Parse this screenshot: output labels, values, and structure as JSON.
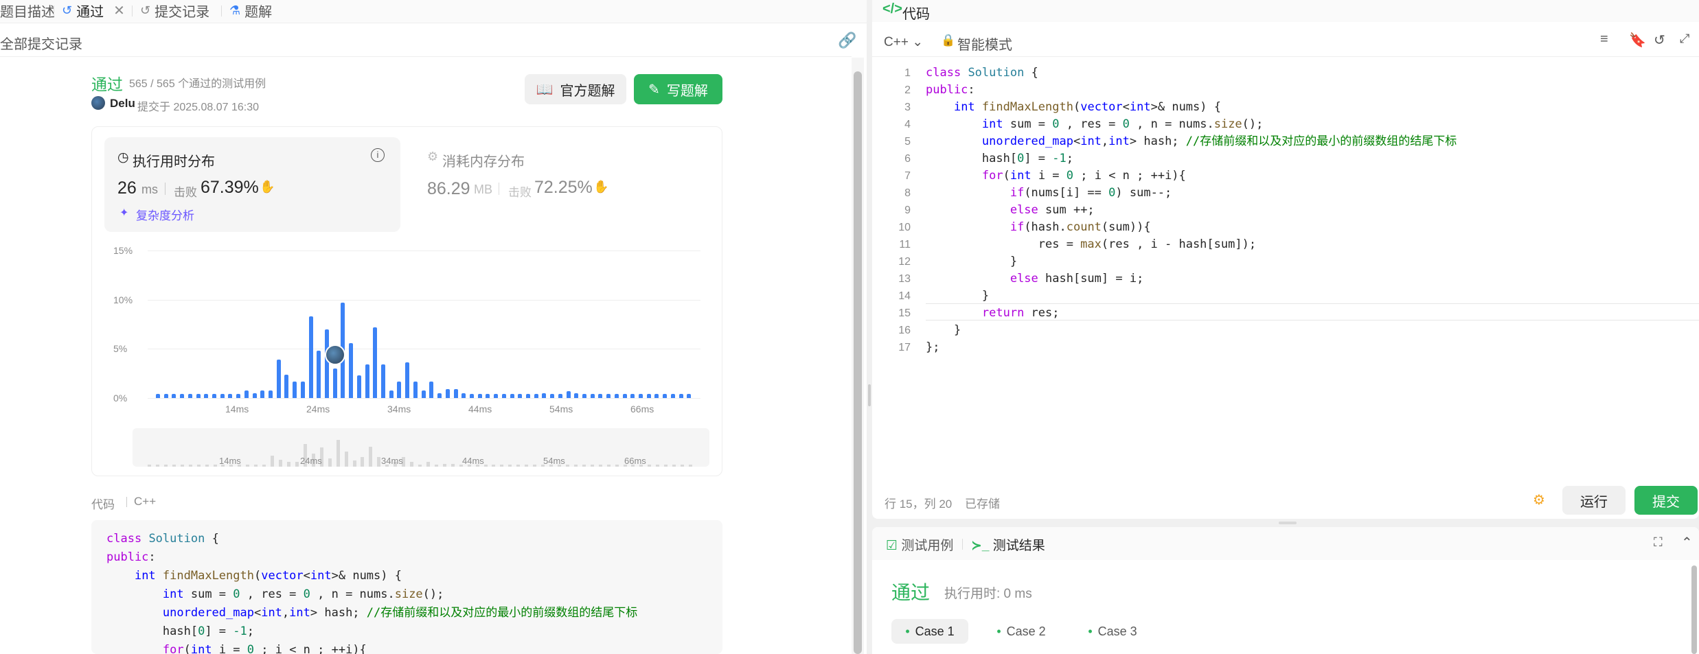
{
  "tabs": {
    "description": "题目描述",
    "passed": "通过",
    "submissions": "提交记录",
    "solutions": "题解"
  },
  "left": {
    "all_submissions": "全部提交记录",
    "status": "通过",
    "testcases": "565 / 565 个通过的测试用例",
    "user": "Delu",
    "submitted_at": "提交于 2025.08.07 16:30",
    "official_solution": "官方题解",
    "write_solution": "写题解",
    "runtime_title": "执行用时分布",
    "runtime_value": "26",
    "runtime_unit": "ms",
    "beats_label": "击败",
    "runtime_beats": "67.39%",
    "complexity": "复杂度分析",
    "memory_title": "消耗内存分布",
    "memory_value": "86.29",
    "memory_unit": "MB",
    "memory_beats": "72.25%",
    "code_label": "代码",
    "lang": "C++"
  },
  "chart_data": {
    "type": "bar",
    "title": "执行用时分布",
    "y_ticks": [
      "15%",
      "10%",
      "5%",
      "0%"
    ],
    "x_ticks": [
      "14ms",
      "24ms",
      "34ms",
      "44ms",
      "54ms",
      "66ms"
    ],
    "ylim": [
      0,
      15
    ],
    "values": [
      0.4,
      0.4,
      0.4,
      0.4,
      0.4,
      0.4,
      0.4,
      0.4,
      0.4,
      0.4,
      0.4,
      0.8,
      0.5,
      0.8,
      0.8,
      3.9,
      2.4,
      1.7,
      1.7,
      8.3,
      4.8,
      7.0,
      3.0,
      9.7,
      5.6,
      2.3,
      3.4,
      7.2,
      3.4,
      0.8,
      1.7,
      3.6,
      1.7,
      0.8,
      1.7,
      0.5,
      0.9,
      0.9,
      0.5,
      0.4,
      0.4,
      0.4,
      0.4,
      0.4,
      0.4,
      0.4,
      0.4,
      0.4,
      0.5,
      0.4,
      0.4,
      0.7,
      0.5,
      0.4,
      0.4,
      0.4,
      0.4,
      0.4,
      0.4,
      0.4,
      0.4,
      0.4,
      0.4,
      0.4,
      0.4,
      0.4,
      0.4
    ],
    "highlight_index": 22
  },
  "editor": {
    "title": "代码",
    "lang": "C++",
    "mode": "智能模式",
    "status": "行 15，列 20",
    "saved": "已存储",
    "run": "运行",
    "submit": "提交"
  },
  "results": {
    "tab_cases": "测试用例",
    "tab_result": "测试结果",
    "status": "通过",
    "runtime": "执行用时: 0 ms",
    "cases": [
      "Case 1",
      "Case 2",
      "Case 3"
    ]
  },
  "code_lines": [
    "class Solution {",
    "public:",
    "    int findMaxLength(vector<int>& nums) {",
    "        int sum = 0 , res = 0 , n = nums.size();",
    "        unordered_map<int,int> hash; //存储前缀和以及对应的最小的前缀数组的结尾下标",
    "        hash[0] = -1;",
    "        for(int i = 0 ; i < n ; ++i){",
    "            if(nums[i] == 0) sum--;",
    "            else sum ++;",
    "            if(hash.count(sum)){",
    "                res = max(res , i - hash[sum]);",
    "            }",
    "            else hash[sum] = i;",
    "        }",
    "        return res;",
    "    }",
    "};"
  ]
}
